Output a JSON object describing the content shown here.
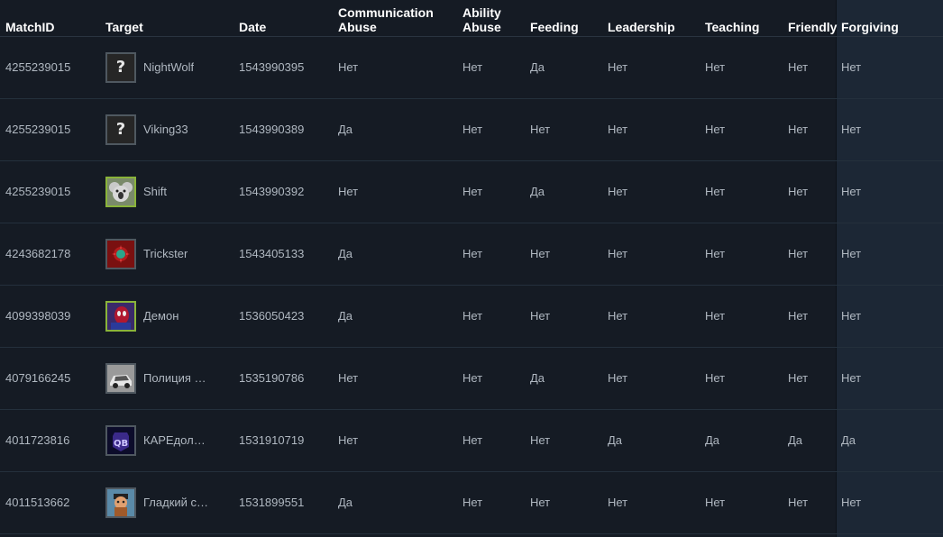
{
  "colors": {
    "background": "#151b24",
    "highlight_column": "#1c2735",
    "text": "#b0b8c1",
    "header_text": "#ffffff",
    "online_border": "#8ab43a"
  },
  "headers": {
    "matchid": "MatchID",
    "target": "Target",
    "date": "Date",
    "communication_abuse": "Communication Abuse",
    "ability_abuse": "Ability Abuse",
    "feeding": "Feeding",
    "leadership": "Leadership",
    "teaching": "Teaching",
    "friendly": "Friendly",
    "forgiving": "Forgiving"
  },
  "rows": [
    {
      "matchid": "4255239015",
      "target": "NightWolf",
      "avatar": "question-mark-avatar",
      "date": "1543990395",
      "communication_abuse": "Нет",
      "ability_abuse": "Нет",
      "feeding": "Да",
      "leadership": "Нет",
      "teaching": "Нет",
      "friendly": "Нет",
      "forgiving": "Нет"
    },
    {
      "matchid": "4255239015",
      "target": "Viking33",
      "avatar": "question-mark-avatar",
      "date": "1543990389",
      "communication_abuse": "Да",
      "ability_abuse": "Нет",
      "feeding": "Нет",
      "leadership": "Нет",
      "teaching": "Нет",
      "friendly": "Нет",
      "forgiving": "Нет"
    },
    {
      "matchid": "4255239015",
      "target": "Shift",
      "avatar": "koala-avatar",
      "date": "1543990392",
      "communication_abuse": "Нет",
      "ability_abuse": "Нет",
      "feeding": "Да",
      "leadership": "Нет",
      "teaching": "Нет",
      "friendly": "Нет",
      "forgiving": "Нет"
    },
    {
      "matchid": "4243682178",
      "target": "Trickster",
      "avatar": "red-emblem-avatar",
      "date": "1543405133",
      "communication_abuse": "Да",
      "ability_abuse": "Нет",
      "feeding": "Нет",
      "leadership": "Нет",
      "teaching": "Нет",
      "friendly": "Нет",
      "forgiving": "Нет"
    },
    {
      "matchid": "4099398039",
      "target": "Демон",
      "avatar": "spider-hero-avatar",
      "date": "1536050423",
      "communication_abuse": "Да",
      "ability_abuse": "Нет",
      "feeding": "Нет",
      "leadership": "Нет",
      "teaching": "Нет",
      "friendly": "Нет",
      "forgiving": "Нет"
    },
    {
      "matchid": "4079166245",
      "target": "Полиция …",
      "avatar": "car-avatar",
      "date": "1535190786",
      "communication_abuse": "Нет",
      "ability_abuse": "Нет",
      "feeding": "Да",
      "leadership": "Нет",
      "teaching": "Нет",
      "friendly": "Нет",
      "forgiving": "Нет"
    },
    {
      "matchid": "4011723816",
      "target": "КАРЕдол…",
      "avatar": "qb-logo-avatar",
      "date": "1531910719",
      "communication_abuse": "Нет",
      "ability_abuse": "Нет",
      "feeding": "Нет",
      "leadership": "Да",
      "teaching": "Да",
      "friendly": "Да",
      "forgiving": "Да"
    },
    {
      "matchid": "4011513662",
      "target": "Гладкий с…",
      "avatar": "cartoon-character-avatar",
      "date": "1531899551",
      "communication_abuse": "Да",
      "ability_abuse": "Нет",
      "feeding": "Нет",
      "leadership": "Нет",
      "teaching": "Нет",
      "friendly": "Нет",
      "forgiving": "Нет"
    }
  ]
}
